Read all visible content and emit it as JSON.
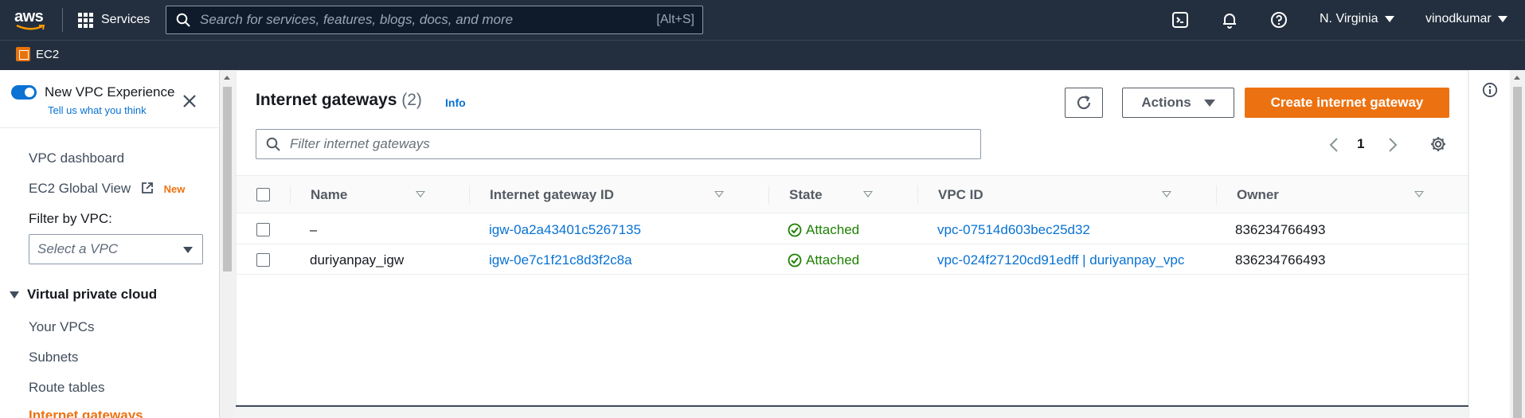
{
  "topnav": {
    "logo_text": "aws",
    "services_label": "Services",
    "search_placeholder": "Search for services, features, blogs, docs, and more",
    "search_shortcut": "[Alt+S]",
    "region": "N. Virginia",
    "user": "vinodkumar",
    "icons": [
      "cloudshell-icon",
      "bell-icon",
      "help-icon"
    ]
  },
  "subnav": {
    "service": "EC2"
  },
  "sidebar": {
    "toggle_label": "New VPC Experience",
    "feedback_link": "Tell us what you think",
    "items": [
      {
        "label": "VPC dashboard"
      },
      {
        "label": "EC2 Global View",
        "badge": "New"
      }
    ],
    "filter_label": "Filter by VPC:",
    "filter_placeholder": "Select a VPC",
    "section": "Virtual private cloud",
    "section_items": [
      {
        "label": "Your VPCs"
      },
      {
        "label": "Subnets"
      },
      {
        "label": "Route tables"
      },
      {
        "label": "Internet gateways",
        "active": true
      }
    ]
  },
  "main": {
    "title": "Internet gateways",
    "count": "(2)",
    "info": "Info",
    "actions_label": "Actions",
    "create_label": "Create internet gateway",
    "filter_placeholder": "Filter internet gateways",
    "page": "1",
    "columns": [
      "Name",
      "Internet gateway ID",
      "State",
      "VPC ID",
      "Owner"
    ],
    "rows": [
      {
        "name": "–",
        "id": "igw-0a2a43401c5267135",
        "state": "Attached",
        "vpc": "vpc-07514d603bec25d32",
        "owner": "836234766493"
      },
      {
        "name": "duriyanpay_igw",
        "id": "igw-0e7c1f21c8d3f2c8a",
        "state": "Attached",
        "vpc": "vpc-024f27120cd91edff | duriyanpay_vpc",
        "owner": "836234766493"
      }
    ]
  },
  "colors": {
    "nav_bg": "#232f3e",
    "primary": "#ec7211",
    "link": "#0972d3",
    "success": "#1d8102"
  }
}
